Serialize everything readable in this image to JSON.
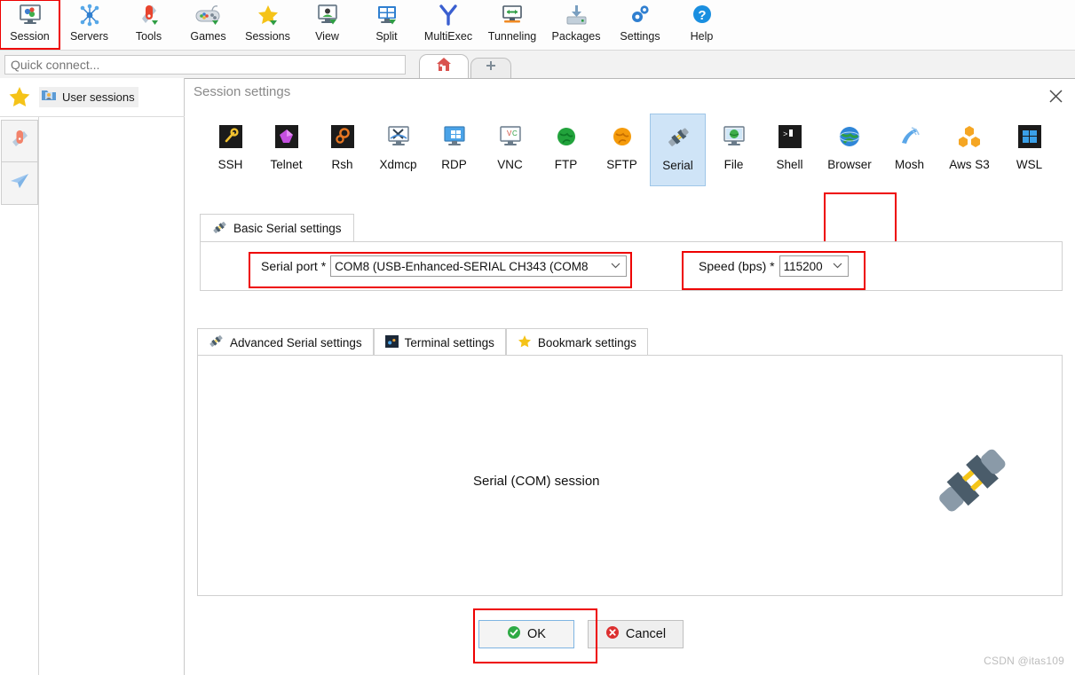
{
  "app": {
    "watermark": "CSDN @itas109"
  },
  "toolbar": {
    "items": [
      {
        "label": "Session",
        "icon": "session-monitor-icon",
        "highlighted": true
      },
      {
        "label": "Servers",
        "icon": "servers-nodes-icon",
        "highlighted": false
      },
      {
        "label": "Tools",
        "icon": "tools-knife-icon",
        "highlighted": false
      },
      {
        "label": "Games",
        "icon": "games-gamepad-icon",
        "highlighted": false
      },
      {
        "label": "Sessions",
        "icon": "sessions-star-icon",
        "highlighted": false
      },
      {
        "label": "View",
        "icon": "view-monitor-icon",
        "highlighted": false
      },
      {
        "label": "Split",
        "icon": "split-panes-icon",
        "highlighted": false
      },
      {
        "label": "MultiExec",
        "icon": "multiexec-fork-icon",
        "highlighted": false
      },
      {
        "label": "Tunneling",
        "icon": "tunneling-arrows-icon",
        "highlighted": false
      },
      {
        "label": "Packages",
        "icon": "packages-box-icon",
        "highlighted": false
      },
      {
        "label": "Settings",
        "icon": "settings-gears-icon",
        "highlighted": false
      },
      {
        "label": "Help",
        "icon": "help-question-icon",
        "highlighted": false
      }
    ]
  },
  "quick_connect": {
    "placeholder": "Quick connect...",
    "value": "",
    "tabs": [
      {
        "name": "home-tab",
        "icon": "home-house-icon"
      },
      {
        "name": "new-tab",
        "icon": "plus-icon"
      }
    ]
  },
  "left_panel": {
    "star_icon": "favorites-star-icon",
    "session_folder": {
      "icon": "user-sessions-folder-icon",
      "label": "User sessions"
    },
    "side_buttons": [
      {
        "name": "tools-sidebar-button",
        "icon": "swiss-knife-icon"
      },
      {
        "name": "macros-sidebar-button",
        "icon": "paper-plane-icon"
      }
    ]
  },
  "dialog": {
    "title": "Session settings",
    "close_icon": "close-icon",
    "session_types": [
      {
        "label": "SSH",
        "icon": "ssh-wrench-icon",
        "selected": false
      },
      {
        "label": "Telnet",
        "icon": "telnet-gem-icon",
        "selected": false
      },
      {
        "label": "Rsh",
        "icon": "rsh-gears-icon",
        "selected": false
      },
      {
        "label": "Xdmcp",
        "icon": "xdmcp-x-icon",
        "selected": false
      },
      {
        "label": "RDP",
        "icon": "rdp-windows-icon",
        "selected": false
      },
      {
        "label": "VNC",
        "icon": "vnc-monitor-icon",
        "selected": false
      },
      {
        "label": "FTP",
        "icon": "ftp-globe-green-icon",
        "selected": false
      },
      {
        "label": "SFTP",
        "icon": "sftp-globe-orange-icon",
        "selected": false
      },
      {
        "label": "Serial",
        "icon": "serial-plug-icon",
        "selected": true
      },
      {
        "label": "File",
        "icon": "file-globe-monitor-icon",
        "selected": false
      },
      {
        "label": "Shell",
        "icon": "shell-terminal-icon",
        "selected": false
      },
      {
        "label": "Browser",
        "icon": "browser-globe-icon",
        "selected": false
      },
      {
        "label": "Mosh",
        "icon": "mosh-satellite-icon",
        "selected": false
      },
      {
        "label": "Aws S3",
        "icon": "aws-s3-cubes-icon",
        "selected": false
      },
      {
        "label": "WSL",
        "icon": "wsl-windows-icon",
        "selected": false
      }
    ],
    "basic_tab": {
      "label": "Basic Serial settings",
      "icon": "serial-plug-icon",
      "serial_port": {
        "label": "Serial port *",
        "value": "COM8  (USB-Enhanced-SERIAL CH343 (COM8",
        "arrow": "chevron-down-icon"
      },
      "speed": {
        "label": "Speed (bps) *",
        "value": "115200",
        "arrow": "chevron-down-icon"
      }
    },
    "lower_tabs": [
      {
        "label": "Advanced Serial settings",
        "icon": "serial-plug-icon",
        "active": true
      },
      {
        "label": "Terminal settings",
        "icon": "terminal-icon",
        "active": false
      },
      {
        "label": "Bookmark settings",
        "icon": "bookmark-star-icon",
        "active": false
      }
    ],
    "content": {
      "caption": "Serial (COM) session",
      "illustration_icon": "serial-plug-large-icon"
    },
    "buttons": {
      "ok": {
        "label": "OK",
        "icon": "check-circle-green-icon"
      },
      "cancel": {
        "label": "Cancel",
        "icon": "cross-circle-red-icon"
      }
    }
  },
  "highlights": {
    "color": "#ee0000",
    "regions": [
      "session-toolbar-button",
      "serial-session-type",
      "serial-port-field",
      "speed-field",
      "ok-button"
    ]
  }
}
